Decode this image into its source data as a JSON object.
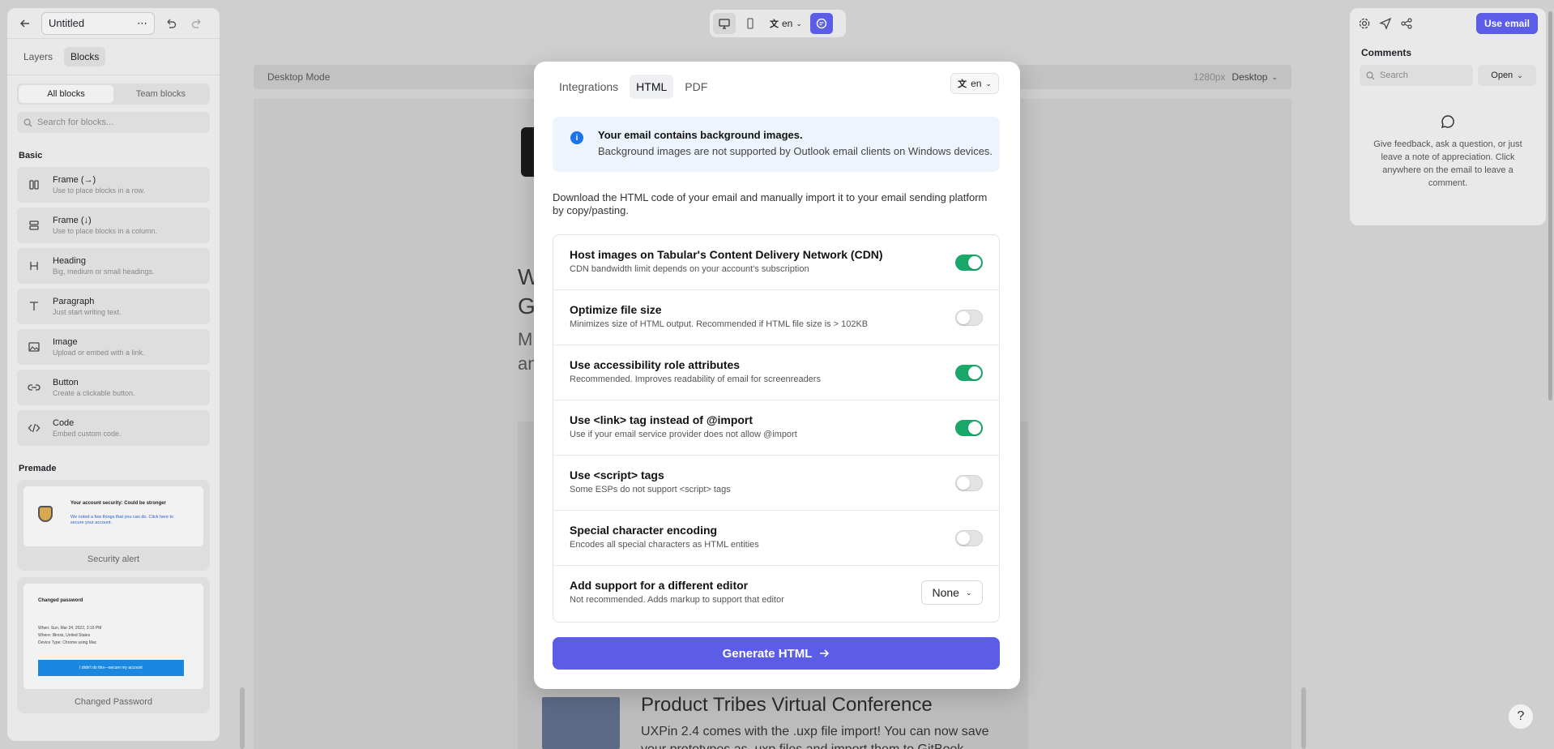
{
  "doc": {
    "title": "Untitled"
  },
  "left": {
    "tabs": [
      "Layers",
      "Blocks"
    ],
    "segments": [
      "All blocks",
      "Team blocks"
    ],
    "search_placeholder": "Search for blocks...",
    "basic_title": "Basic",
    "blocks": [
      {
        "name": "Frame (→)",
        "desc": "Use to place blocks in a row.",
        "icon": "columns-icon"
      },
      {
        "name": "Frame (↓)",
        "desc": "Use to place blocks in a column.",
        "icon": "rows-icon"
      },
      {
        "name": "Heading",
        "desc": "Big, medium or small headings.",
        "icon": "heading-icon"
      },
      {
        "name": "Paragraph",
        "desc": "Just start writing text.",
        "icon": "text-icon"
      },
      {
        "name": "Image",
        "desc": "Upload or embed with a link.",
        "icon": "image-icon"
      },
      {
        "name": "Button",
        "desc": "Create a clickable button.",
        "icon": "link-icon"
      },
      {
        "name": "Code",
        "desc": "Embed custom code.",
        "icon": "code-icon"
      }
    ],
    "premade_title": "Premade",
    "premade": [
      {
        "label": "Security alert",
        "card_title": "Your account security: Could be stronger",
        "card_text": "We noted a few things that you can do. Click here to secure your account."
      },
      {
        "label": "Changed Password",
        "card_title": "Changed password",
        "card_lines": [
          "When: Sun, Mar 24, 2022, 3:16 PM",
          "Where: Illinois, United States",
          "Device Type: Chrome using Mac"
        ],
        "card_button": "I didn't do this—secure my account"
      }
    ]
  },
  "toolbar": {
    "lang": "en"
  },
  "canvas": {
    "mode_label": "Desktop Mode",
    "width_label": "1280px",
    "device": "Desktop",
    "promo_title": "Product Tribes Virtual Conference",
    "promo_text": "UXPin 2.4 comes with the .uxp file import! You can now save your prototypes as .uxp files and import them to GitBook",
    "ghost_heading": [
      "W",
      "G"
    ],
    "ghost_sub": [
      "M",
      "an"
    ]
  },
  "right": {
    "use_email": "Use email",
    "comments_title": "Comments",
    "search_placeholder": "Search",
    "filter": "Open",
    "empty_text": "Give feedback, ask a question, or just leave a note of appreciation. Click anywhere on the email to leave a comment."
  },
  "modal": {
    "tabs": [
      "Integrations",
      "HTML",
      "PDF"
    ],
    "active_tab": "HTML",
    "lang": "en",
    "banner": {
      "title": "Your email contains background images.",
      "text": "Background images are not supported by Outlook email clients on Windows devices."
    },
    "description": "Download the HTML code of your email and manually import it to your email sending platform by copy/pasting.",
    "options": [
      {
        "name": "Host images on Tabular's Content Delivery Network (CDN)",
        "desc": "CDN bandwidth limit depends on your account's subscription",
        "on": true
      },
      {
        "name": "Optimize file size",
        "desc": "Minimizes size of HTML output. Recommended if HTML file size is > 102KB",
        "on": false
      },
      {
        "name": "Use accessibility role attributes",
        "desc": "Recommended. Improves readability of email for screenreaders",
        "on": true
      },
      {
        "name": "Use <link> tag instead of @import",
        "desc": "Use if your email service provider does not allow @import",
        "on": true
      },
      {
        "name": "Use <script> tags",
        "desc": "Some ESPs do not support <script> tags",
        "on": false
      },
      {
        "name": "Special character encoding",
        "desc": "Encodes all special characters as HTML entities",
        "on": false
      }
    ],
    "editor_option": {
      "name": "Add support for a different editor",
      "desc": "Not recommended. Adds markup to support that editor",
      "value": "None"
    },
    "generate_label": "Generate HTML"
  },
  "colors": {
    "accent": "#5b5de6",
    "toggle_on": "#1aa86a",
    "info": "#1a73e8"
  }
}
